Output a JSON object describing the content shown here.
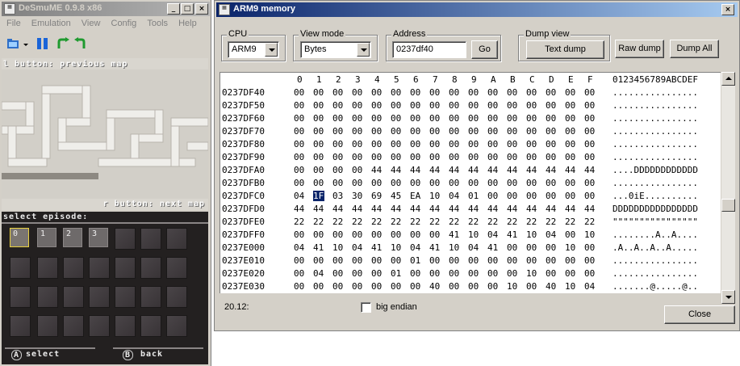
{
  "desmume": {
    "title": "DeSmuME 0.9.8 x86",
    "menu": [
      "File",
      "Emulation",
      "View",
      "Config",
      "Tools",
      "Help"
    ],
    "top_screen": {
      "header": "l button: previous map",
      "footer": "r button: next map"
    },
    "bottom_screen": {
      "label": "select episode:",
      "episodes": [
        "0",
        "1",
        "2",
        "3"
      ],
      "select_hint": "select",
      "back_hint": "back",
      "a_glyph": "A",
      "b_glyph": "B"
    }
  },
  "arm9": {
    "title": "ARM9 memory",
    "cpu": {
      "label": "CPU",
      "value": "ARM9"
    },
    "view_mode": {
      "label": "View mode",
      "value": "Bytes"
    },
    "address": {
      "label": "Address",
      "value": "0237df40",
      "go": "Go"
    },
    "dump_view": {
      "label": "Dump view",
      "text_dump": "Text dump",
      "raw_dump": "Raw dump",
      "dump_all": "Dump All"
    },
    "memory": {
      "columns": [
        "0",
        "1",
        "2",
        "3",
        "4",
        "5",
        "6",
        "7",
        "8",
        "9",
        "A",
        "B",
        "C",
        "D",
        "E",
        "F"
      ],
      "ascii_header": "0123456789ABCDEF",
      "rows": [
        {
          "addr": "0237DF40",
          "bytes": [
            "00",
            "00",
            "00",
            "00",
            "00",
            "00",
            "00",
            "00",
            "00",
            "00",
            "00",
            "00",
            "00",
            "00",
            "00",
            "00"
          ],
          "ascii": "................"
        },
        {
          "addr": "0237DF50",
          "bytes": [
            "00",
            "00",
            "00",
            "00",
            "00",
            "00",
            "00",
            "00",
            "00",
            "00",
            "00",
            "00",
            "00",
            "00",
            "00",
            "00"
          ],
          "ascii": "................"
        },
        {
          "addr": "0237DF60",
          "bytes": [
            "00",
            "00",
            "00",
            "00",
            "00",
            "00",
            "00",
            "00",
            "00",
            "00",
            "00",
            "00",
            "00",
            "00",
            "00",
            "00"
          ],
          "ascii": "................"
        },
        {
          "addr": "0237DF70",
          "bytes": [
            "00",
            "00",
            "00",
            "00",
            "00",
            "00",
            "00",
            "00",
            "00",
            "00",
            "00",
            "00",
            "00",
            "00",
            "00",
            "00"
          ],
          "ascii": "................"
        },
        {
          "addr": "0237DF80",
          "bytes": [
            "00",
            "00",
            "00",
            "00",
            "00",
            "00",
            "00",
            "00",
            "00",
            "00",
            "00",
            "00",
            "00",
            "00",
            "00",
            "00"
          ],
          "ascii": "................"
        },
        {
          "addr": "0237DF90",
          "bytes": [
            "00",
            "00",
            "00",
            "00",
            "00",
            "00",
            "00",
            "00",
            "00",
            "00",
            "00",
            "00",
            "00",
            "00",
            "00",
            "00"
          ],
          "ascii": "................"
        },
        {
          "addr": "0237DFA0",
          "bytes": [
            "00",
            "00",
            "00",
            "00",
            "44",
            "44",
            "44",
            "44",
            "44",
            "44",
            "44",
            "44",
            "44",
            "44",
            "44",
            "44"
          ],
          "ascii": "....DDDDDDDDDDDD"
        },
        {
          "addr": "0237DFB0",
          "bytes": [
            "00",
            "00",
            "00",
            "00",
            "00",
            "00",
            "00",
            "00",
            "00",
            "00",
            "00",
            "00",
            "00",
            "00",
            "00",
            "00"
          ],
          "ascii": "................"
        },
        {
          "addr": "0237DFC0",
          "bytes": [
            "04",
            "1F",
            "03",
            "30",
            "69",
            "45",
            "EA",
            "10",
            "04",
            "01",
            "00",
            "00",
            "00",
            "00",
            "00",
            "00"
          ],
          "ascii": "...0iE.........."
        },
        {
          "addr": "0237DFD0",
          "bytes": [
            "44",
            "44",
            "44",
            "44",
            "44",
            "44",
            "44",
            "44",
            "44",
            "44",
            "44",
            "44",
            "44",
            "44",
            "44",
            "44"
          ],
          "ascii": "DDDDDDDDDDDDDDDD"
        },
        {
          "addr": "0237DFE0",
          "bytes": [
            "22",
            "22",
            "22",
            "22",
            "22",
            "22",
            "22",
            "22",
            "22",
            "22",
            "22",
            "22",
            "22",
            "22",
            "22",
            "22"
          ],
          "ascii": "\"\"\"\"\"\"\"\"\"\"\"\"\"\"\"\""
        },
        {
          "addr": "0237DFF0",
          "bytes": [
            "00",
            "00",
            "00",
            "00",
            "00",
            "00",
            "00",
            "00",
            "41",
            "10",
            "04",
            "41",
            "10",
            "04",
            "00",
            "10"
          ],
          "ascii": "........A..A...."
        },
        {
          "addr": "0237E000",
          "bytes": [
            "04",
            "41",
            "10",
            "04",
            "41",
            "10",
            "04",
            "41",
            "10",
            "04",
            "41",
            "00",
            "00",
            "00",
            "10",
            "00"
          ],
          "ascii": ".A..A..A..A....."
        },
        {
          "addr": "0237E010",
          "bytes": [
            "00",
            "00",
            "00",
            "00",
            "00",
            "00",
            "01",
            "00",
            "00",
            "00",
            "00",
            "00",
            "00",
            "00",
            "00",
            "00"
          ],
          "ascii": "................"
        },
        {
          "addr": "0237E020",
          "bytes": [
            "00",
            "04",
            "00",
            "00",
            "00",
            "01",
            "00",
            "00",
            "00",
            "00",
            "00",
            "00",
            "10",
            "00",
            "00",
            "00"
          ],
          "ascii": "................"
        },
        {
          "addr": "0237E030",
          "bytes": [
            "00",
            "00",
            "00",
            "00",
            "00",
            "00",
            "00",
            "40",
            "00",
            "00",
            "00",
            "10",
            "00",
            "40",
            "10",
            "04"
          ],
          "ascii": ".......@.....@.."
        }
      ],
      "selected": {
        "row": 8,
        "col": 1
      }
    },
    "status_text": "20.12:",
    "big_endian": {
      "label": "big endian",
      "checked": false
    },
    "close": "Close"
  }
}
